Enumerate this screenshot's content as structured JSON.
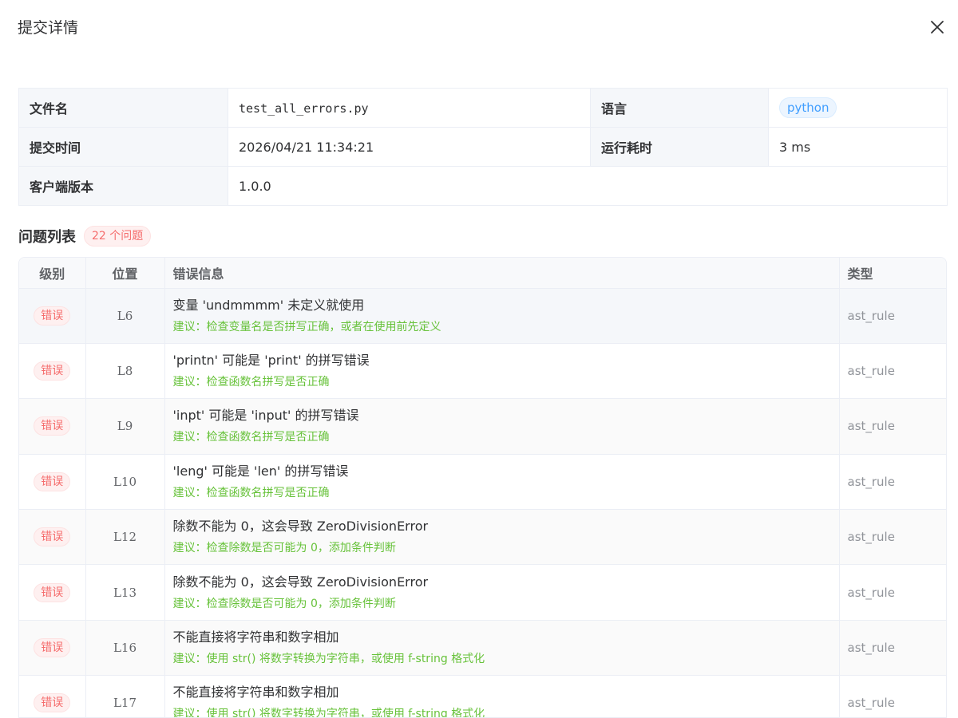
{
  "dialog": {
    "title": "提交详情"
  },
  "info": {
    "filename_label": "文件名",
    "filename": "test_all_errors.py",
    "language_label": "语言",
    "language": "python",
    "submit_time_label": "提交时间",
    "submit_time": "2026/04/21 11:34:21",
    "duration_label": "运行耗时",
    "duration": "3 ms",
    "client_version_label": "客户端版本",
    "client_version": "1.0.0"
  },
  "issues": {
    "title": "问题列表",
    "count": "22 个问题",
    "columns": {
      "level": "级别",
      "position": "位置",
      "message": "错误信息",
      "type": "类型"
    },
    "rows": [
      {
        "level": "错误",
        "position": "L6",
        "message": "变量 'undmmmm' 未定义就使用",
        "suggestion": "建议：检查变量名是否拼写正确，或者在使用前先定义",
        "type": "ast_rule"
      },
      {
        "level": "错误",
        "position": "L8",
        "message": "'printn' 可能是 'print' 的拼写错误",
        "suggestion": "建议：检查函数名拼写是否正确",
        "type": "ast_rule"
      },
      {
        "level": "错误",
        "position": "L9",
        "message": "'inpt' 可能是 'input' 的拼写错误",
        "suggestion": "建议：检查函数名拼写是否正确",
        "type": "ast_rule"
      },
      {
        "level": "错误",
        "position": "L10",
        "message": "'leng' 可能是 'len' 的拼写错误",
        "suggestion": "建议：检查函数名拼写是否正确",
        "type": "ast_rule"
      },
      {
        "level": "错误",
        "position": "L12",
        "message": "除数不能为 0，这会导致 ZeroDivisionError",
        "suggestion": "建议：检查除数是否可能为 0，添加条件判断",
        "type": "ast_rule"
      },
      {
        "level": "错误",
        "position": "L13",
        "message": "除数不能为 0，这会导致 ZeroDivisionError",
        "suggestion": "建议：检查除数是否可能为 0，添加条件判断",
        "type": "ast_rule"
      },
      {
        "level": "错误",
        "position": "L16",
        "message": "不能直接将字符串和数字相加",
        "suggestion": "建议：使用 str() 将数字转换为字符串，或使用 f-string 格式化",
        "type": "ast_rule"
      },
      {
        "level": "错误",
        "position": "L17",
        "message": "不能直接将字符串和数字相加",
        "suggestion": "建议：使用 str() 将数字转换为字符串，或使用 f-string 格式化",
        "type": "ast_rule"
      }
    ]
  }
}
